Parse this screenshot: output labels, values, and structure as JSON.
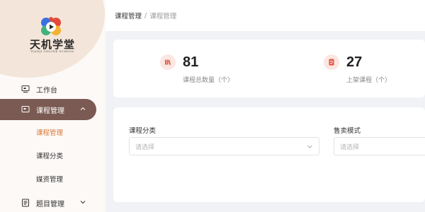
{
  "brand": {
    "title": "天机学堂",
    "subtitle": "TIANJI ONLINE SCHOOL",
    "colors": {
      "accent": "#7a5a52",
      "highlight": "#d97935",
      "logo_blue": "#3a6fe0",
      "logo_red": "#e24a3b",
      "logo_green": "#3fb37a",
      "logo_yellow": "#f2b233"
    }
  },
  "sidebar": {
    "items": [
      {
        "label": "工作台",
        "icon": "monitor-icon"
      },
      {
        "label": "课程管理",
        "icon": "course-icon",
        "expanded": true
      },
      {
        "label": "题目管理",
        "icon": "question-icon",
        "expanded": false
      }
    ],
    "sub_items": [
      {
        "label": "课程管理",
        "current": true
      },
      {
        "label": "课程分类",
        "current": false
      },
      {
        "label": "媒资管理",
        "current": false
      }
    ]
  },
  "breadcrumb": {
    "parent": "课程管理",
    "separator": "/",
    "current": "课程管理"
  },
  "stats": [
    {
      "value": "81",
      "label": "课程总数量（个）",
      "icon": "books-icon"
    },
    {
      "value": "27",
      "label": "上架课程（个）",
      "icon": "document-icon"
    }
  ],
  "filters": [
    {
      "label": "课程分类",
      "placeholder": "请选择"
    },
    {
      "label": "售卖模式",
      "placeholder": "请选择"
    }
  ]
}
